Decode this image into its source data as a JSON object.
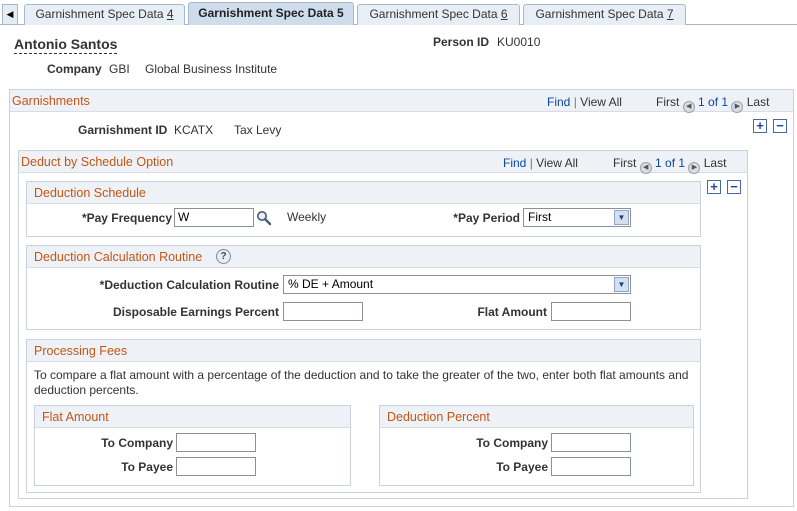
{
  "tabs": {
    "scroll_left": "◀",
    "items": [
      {
        "label": "Garnishment Spec Data ",
        "num": "4",
        "active": false
      },
      {
        "label": "Garnishment Spec Data ",
        "num": "5",
        "active": true
      },
      {
        "label": "Garnishment Spec Data ",
        "num": "6",
        "active": false
      },
      {
        "label": "Garnishment Spec Data ",
        "num": "7",
        "active": false
      }
    ]
  },
  "header": {
    "employee_name": "Antonio Santos",
    "person_id_label": "Person ID",
    "person_id": "KU0010",
    "company_label": "Company",
    "company_code": "GBI",
    "company_name": "Global Business Institute"
  },
  "garnishments": {
    "title": "Garnishments",
    "find": "Find",
    "sep": "|",
    "view_all": "View All",
    "first": "First",
    "pager": "1 of 1",
    "last": "Last",
    "garnishment_id_label": "Garnishment ID",
    "garnishment_id": "KCATX",
    "garnishment_desc": "Tax Levy"
  },
  "deduct_option": {
    "title": "Deduct by Schedule Option",
    "find": "Find",
    "sep": "|",
    "view_all": "View All",
    "first": "First",
    "pager": "1 of 1",
    "last": "Last"
  },
  "deduction_schedule": {
    "title": "Deduction Schedule",
    "pay_frequency_label": "*Pay Frequency",
    "pay_frequency_value": "W",
    "pay_frequency_desc": "Weekly",
    "pay_period_label": "*Pay Period",
    "pay_period_value": "First"
  },
  "calc_routine": {
    "title": "Deduction Calculation Routine",
    "help": "?",
    "routine_label": "*Deduction Calculation Routine",
    "routine_value": "% DE + Amount",
    "disposable_label": "Disposable Earnings Percent",
    "disposable_value": "",
    "flat_amount_label": "Flat Amount",
    "flat_amount_value": ""
  },
  "processing_fees": {
    "title": "Processing Fees",
    "instructions_line1": "To compare a flat amount with a percentage of the deduction and to take the greater of the two, enter both flat amounts and",
    "instructions_line2": "deduction percents.",
    "flat_amount": {
      "title": "Flat Amount",
      "to_company_label": "To Company",
      "to_company_value": "",
      "to_payee_label": "To Payee",
      "to_payee_value": ""
    },
    "deduction_percent": {
      "title": "Deduction Percent",
      "to_company_label": "To Company",
      "to_company_value": "",
      "to_payee_label": "To Payee",
      "to_payee_value": ""
    }
  },
  "icons": {
    "plus": "+",
    "minus": "−",
    "prev": "◀",
    "next": "▶",
    "dropdown": "▼"
  }
}
